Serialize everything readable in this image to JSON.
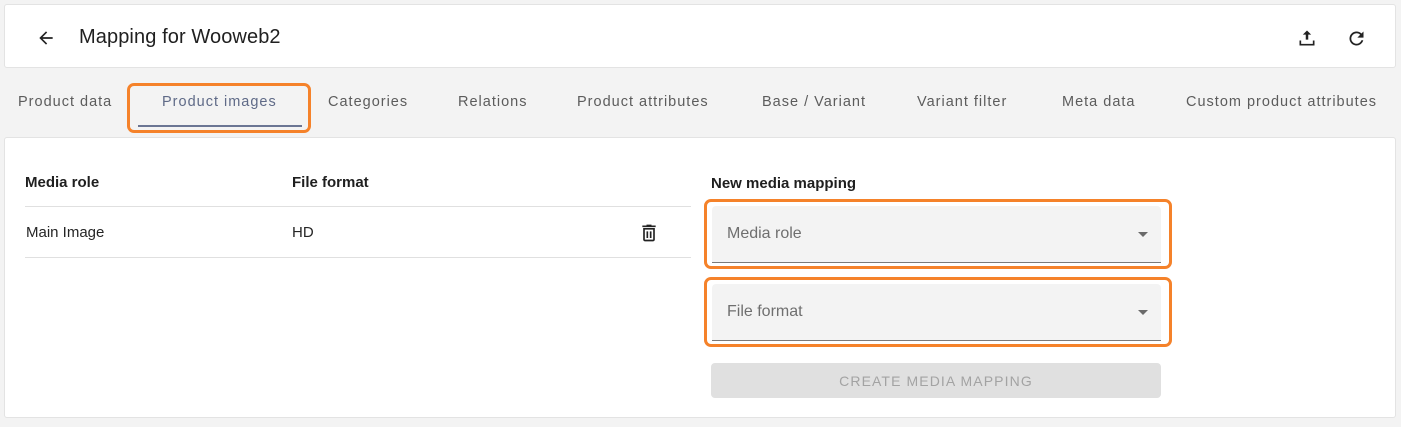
{
  "header": {
    "title": "Mapping for Wooweb2",
    "back_icon": "arrow-left-icon",
    "upload_icon": "upload-icon",
    "refresh_icon": "refresh-icon"
  },
  "tabs": [
    {
      "label": "Product data",
      "active": false
    },
    {
      "label": "Product images",
      "active": true
    },
    {
      "label": "Categories",
      "active": false
    },
    {
      "label": "Relations",
      "active": false
    },
    {
      "label": "Product attributes",
      "active": false
    },
    {
      "label": "Base / Variant",
      "active": false
    },
    {
      "label": "Variant filter",
      "active": false
    },
    {
      "label": "Meta data",
      "active": false
    },
    {
      "label": "Custom product attributes",
      "active": false
    }
  ],
  "table": {
    "columns": [
      "Media role",
      "File format"
    ],
    "rows": [
      {
        "media_role": "Main Image",
        "file_format": "HD",
        "action_icon": "trash-icon"
      }
    ]
  },
  "new_mapping": {
    "title": "New media mapping",
    "media_role_placeholder": "Media role",
    "file_format_placeholder": "File format",
    "create_button": "CREATE MEDIA MAPPING",
    "create_disabled": true
  },
  "colors": {
    "highlight": "#f5822a",
    "active_tab": "#5f6a87",
    "background": "#f3f3f3"
  }
}
